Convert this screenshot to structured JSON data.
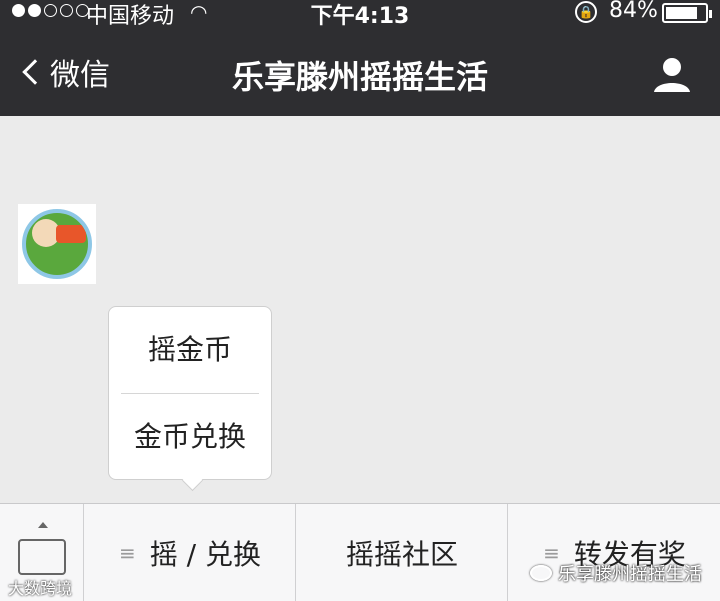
{
  "status_bar": {
    "carrier": "中国移动",
    "time": "下午4:13",
    "battery_percent": "84%",
    "battery_level": 0.84
  },
  "nav": {
    "back_label": "微信",
    "title": "乐享滕州摇摇生活"
  },
  "popup_menu": {
    "items": [
      {
        "label": "摇金币"
      },
      {
        "label": "金币兑换"
      }
    ]
  },
  "bottom_menu": {
    "items": [
      {
        "label": "摇 / 兑换",
        "icon": "menu-icon"
      },
      {
        "label": "摇摇社区"
      },
      {
        "label": "转发有奖",
        "icon": "menu-icon"
      }
    ]
  },
  "overlay": {
    "watermark": "乐享滕州摇摇生活",
    "corner_logo": "大数跨境"
  }
}
